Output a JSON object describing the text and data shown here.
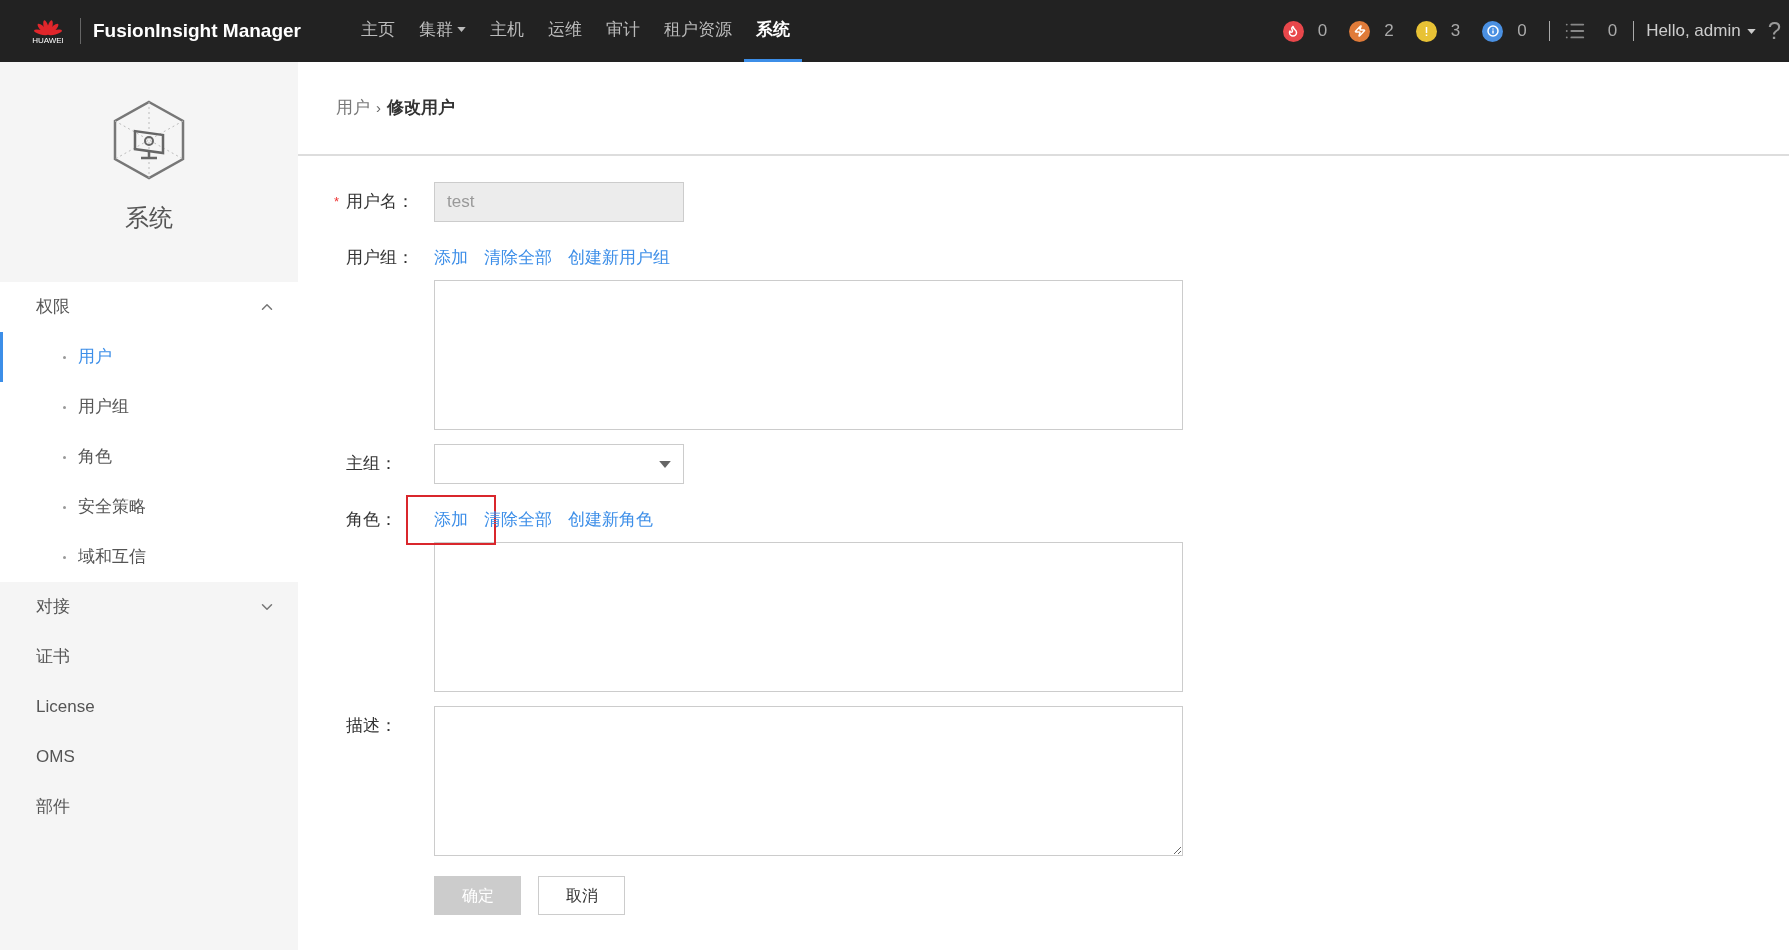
{
  "header": {
    "brand": "HUAWEI",
    "title": "FusionInsight Manager",
    "nav": [
      {
        "label": "主页",
        "selected": false,
        "dropdown": false
      },
      {
        "label": "集群",
        "selected": false,
        "dropdown": true
      },
      {
        "label": "主机",
        "selected": false,
        "dropdown": false
      },
      {
        "label": "运维",
        "selected": false,
        "dropdown": false
      },
      {
        "label": "审计",
        "selected": false,
        "dropdown": false
      },
      {
        "label": "租户资源",
        "selected": false,
        "dropdown": false
      },
      {
        "label": "系统",
        "selected": true,
        "dropdown": false
      }
    ],
    "alarms": [
      {
        "kind": "critical",
        "color": "#e8474b",
        "count": "0"
      },
      {
        "kind": "major",
        "color": "#e07b39",
        "count": "2"
      },
      {
        "kind": "minor",
        "color": "#e8c235",
        "count": "3"
      },
      {
        "kind": "info",
        "color": "#4a90e2",
        "count": "0"
      }
    ],
    "tasks": {
      "count": "0"
    },
    "user": "Hello, admin",
    "help": "?"
  },
  "sidebar": {
    "title": "系统",
    "items": [
      {
        "label": "权限",
        "expandable": true,
        "expanded": true,
        "children": [
          {
            "label": "用户",
            "selected": true
          },
          {
            "label": "用户组",
            "selected": false
          },
          {
            "label": "角色",
            "selected": false
          },
          {
            "label": "安全策略",
            "selected": false
          },
          {
            "label": "域和互信",
            "selected": false
          }
        ]
      },
      {
        "label": "对接",
        "expandable": true,
        "expanded": false
      },
      {
        "label": "证书",
        "expandable": false
      },
      {
        "label": "License",
        "expandable": false
      },
      {
        "label": "OMS",
        "expandable": false
      },
      {
        "label": "部件",
        "expandable": false
      }
    ]
  },
  "breadcrumb": [
    {
      "label": "用户",
      "current": false
    },
    {
      "separator": "›"
    },
    {
      "label": "修改用户",
      "current": true
    }
  ],
  "form": {
    "fields": [
      {
        "kind": "text",
        "mark": "*",
        "label": "用户名：",
        "value": "test",
        "disabled": true
      },
      {
        "kind": "list",
        "label": "用户组：",
        "actions": [
          {
            "label": "添加",
            "highlighted": false
          },
          {
            "label": "清除全部",
            "highlighted": false
          },
          {
            "label": "创建新用户组",
            "highlighted": false
          }
        ]
      },
      {
        "kind": "select",
        "label": "主组："
      },
      {
        "kind": "list",
        "label": "角色：",
        "actions": [
          {
            "label": "添加",
            "highlighted": true
          },
          {
            "label": "清除全部",
            "highlighted": false
          },
          {
            "label": "创建新角色",
            "highlighted": false
          }
        ]
      },
      {
        "kind": "textarea",
        "label": "描述："
      }
    ],
    "buttons": [
      {
        "label": "确定",
        "disabled": true
      },
      {
        "label": "取消",
        "disabled": false
      }
    ]
  }
}
